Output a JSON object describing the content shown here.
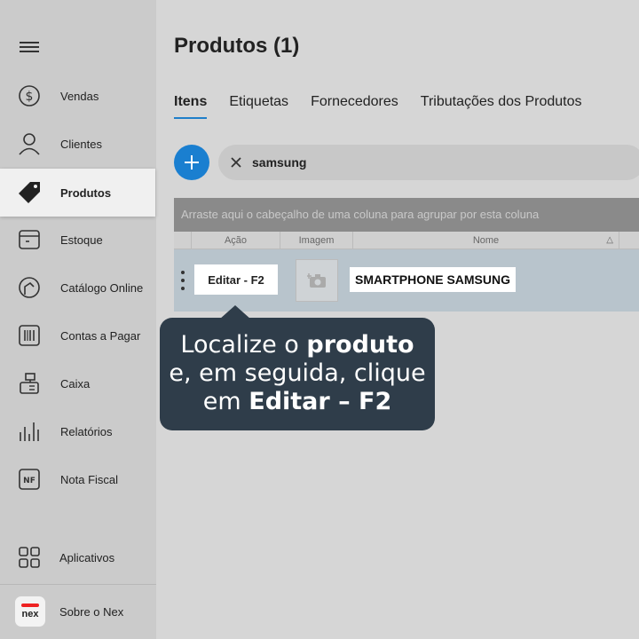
{
  "sidebar": {
    "items": [
      {
        "label": "Vendas",
        "icon": "dollar-icon"
      },
      {
        "label": "Clientes",
        "icon": "person-icon"
      },
      {
        "label": "Produtos",
        "icon": "tag-icon",
        "active": true
      },
      {
        "label": "Estoque",
        "icon": "box-icon"
      },
      {
        "label": "Catálogo Online",
        "icon": "catalog-icon"
      },
      {
        "label": "Contas a Pagar",
        "icon": "barcode-icon"
      },
      {
        "label": "Caixa",
        "icon": "cash-register-icon"
      },
      {
        "label": "Relatórios",
        "icon": "bar-chart-icon"
      },
      {
        "label": "Nota Fiscal",
        "icon": "nf-icon"
      }
    ],
    "apps_label": "Aplicativos",
    "about_label": "Sobre o Nex",
    "logo_text": "nex",
    "nf_icon_text": "NF"
  },
  "header": {
    "title": "Produtos (1)"
  },
  "tabs": [
    {
      "label": "Itens",
      "active": true
    },
    {
      "label": "Etiquetas"
    },
    {
      "label": "Fornecedores"
    },
    {
      "label": "Tributações dos Produtos"
    }
  ],
  "search": {
    "value": "samsung"
  },
  "grid": {
    "group_hint": "Arraste aqui o cabeçalho de uma coluna para agrupar por esta coluna",
    "columns": [
      "Ação",
      "Imagem",
      "Nome"
    ],
    "rows": [
      {
        "action": "Editar - F2",
        "name": "SMARTPHONE SAMSUNG"
      }
    ]
  },
  "tooltip": {
    "line1_pre": "Localize o ",
    "line1_bold": "produto",
    "line2": "e, em seguida, clique",
    "line3_pre": "em ",
    "line3_bold": "Editar – F2"
  },
  "colors": {
    "accent": "#1a7fd0",
    "tooltip_bg": "#2f3d4a",
    "selected_row": "#b8c4cc"
  }
}
